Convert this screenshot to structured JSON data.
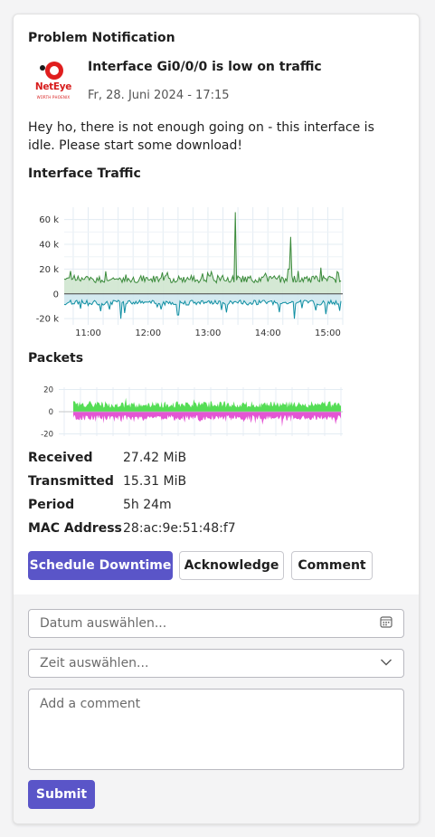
{
  "card": {
    "title": "Problem Notification"
  },
  "logo": {
    "brand": "NetEye",
    "sub": "WÜRTH PHOENIX"
  },
  "notification": {
    "title": "Interface Gi0/0/0 is low on traffic",
    "date": "Fr, 28. Juni 2024 - 17:15",
    "message": "Hey ho, there is not enough going on - this interface is idle. Please start some download!"
  },
  "traffic_chart": {
    "section_title": "Interface Traffic",
    "chart_data": {
      "type": "area",
      "title": "Interface Traffic",
      "x_ticks": [
        "11:00",
        "12:00",
        "13:00",
        "14:00",
        "15:00"
      ],
      "y_ticks": [
        "60 k",
        "40 k",
        "20 k",
        "0",
        "-20 k"
      ],
      "ylim": [
        -25000,
        70000
      ],
      "grid": true,
      "series": [
        {
          "color": "#3a8a3a",
          "baseline": 12000,
          "spikes": [
            [
              13.45,
              66000
            ],
            [
              14.38,
              46000
            ],
            [
              13.05,
              18000
            ],
            [
              14.35,
              20000
            ]
          ]
        },
        {
          "color": "#0f8fa3",
          "baseline": -7000,
          "dips": [
            [
              11.55,
              -20000
            ],
            [
              12.5,
              -17000
            ],
            [
              13.3,
              -15000
            ],
            [
              14.45,
              -20000
            ],
            [
              11.2,
              -14000
            ]
          ]
        }
      ]
    }
  },
  "packets_chart": {
    "section_title": "Packets",
    "chart_data": {
      "type": "area",
      "title": "Packets",
      "y_ticks": [
        "20",
        "0",
        "-20"
      ],
      "ylim": [
        -22,
        22
      ],
      "grid": true,
      "series": [
        {
          "color": "#55dd55",
          "baseline": 6
        },
        {
          "color": "#e455d4",
          "baseline": -5
        }
      ]
    }
  },
  "properties": [
    {
      "key": "Received",
      "value": "27.42 MiB"
    },
    {
      "key": "Transmitted",
      "value": "15.31 MiB"
    },
    {
      "key": "Period",
      "value": "5h 24m"
    },
    {
      "key": "MAC Address",
      "value": "28:ac:9e:51:48:f7"
    }
  ],
  "actions": {
    "schedule_downtime": "Schedule Downtime",
    "acknowledge": "Acknowledge",
    "comment": "Comment"
  },
  "form": {
    "date_placeholder": "Datum auswählen...",
    "time_placeholder": "Zeit auswählen...",
    "comment_placeholder": "Add a comment",
    "submit": "Submit"
  },
  "colors": {
    "primary": "#5a55c8",
    "brand_red": "#d71c1c"
  }
}
